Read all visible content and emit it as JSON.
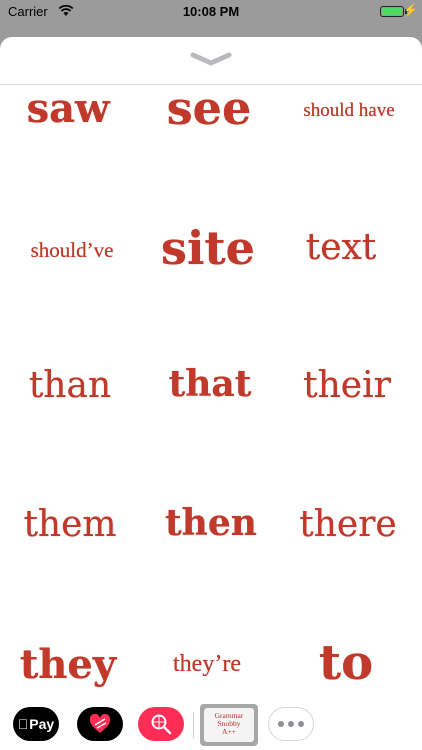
{
  "status_bar": {
    "carrier": "Carrier",
    "time": "10:08 PM",
    "battery_level": 1.0
  },
  "stickers": {
    "saw": "saw",
    "see": "see",
    "should_have": "should have",
    "shouldve": "should’ve",
    "site": "site",
    "text": "text",
    "than": "than",
    "that": "that",
    "their": "their",
    "them": "them",
    "then": "then",
    "there": "there",
    "they": "they",
    "theyre": "they’re",
    "to": "to"
  },
  "drawer": {
    "applepay_label": "Pay",
    "grammar_line1": "Grammar",
    "grammar_line2": "Snobby",
    "grammar_line3": "A++"
  },
  "colors": {
    "sticker_red": "#c0392b",
    "battery_green": "#4cd964",
    "search_app_pink": "#ff2d55"
  }
}
